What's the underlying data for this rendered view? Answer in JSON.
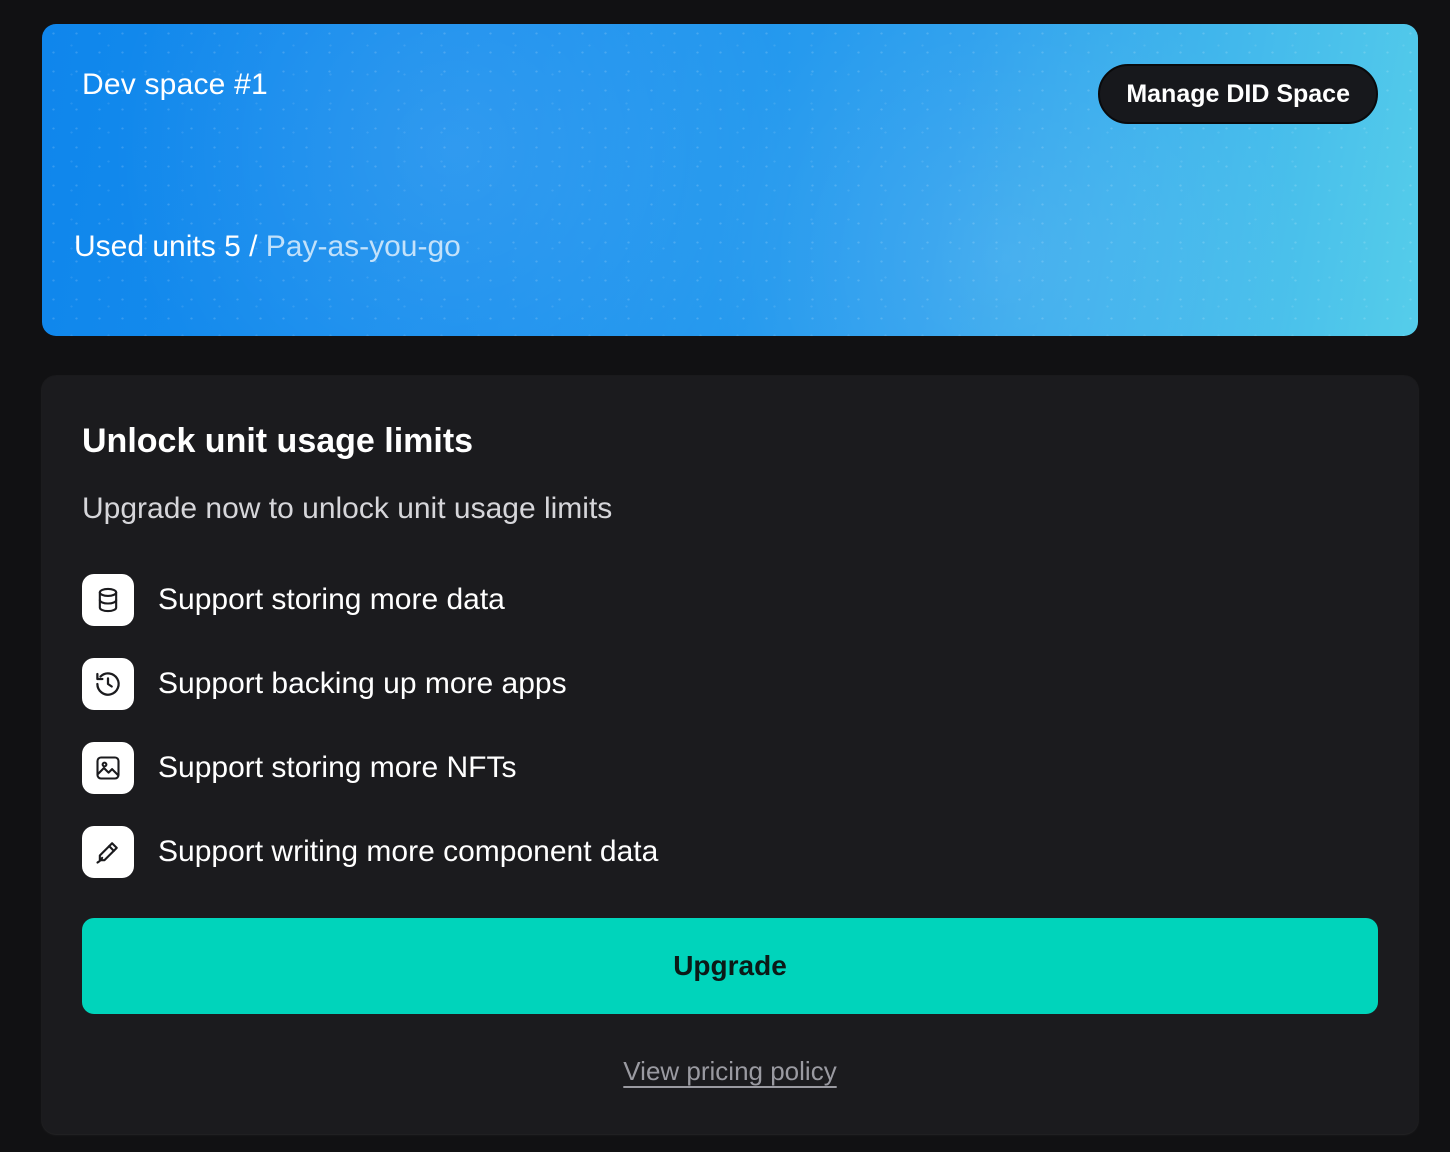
{
  "space": {
    "title": "Dev space #1",
    "manage_button": "Manage DID Space",
    "units_prefix": "Used units 5 / ",
    "plan": "Pay-as-you-go"
  },
  "upgrade": {
    "title": "Unlock unit usage limits",
    "subtitle": "Upgrade now to unlock unit usage limits",
    "features": [
      {
        "icon": "database-icon",
        "label": "Support storing more data"
      },
      {
        "icon": "history-icon",
        "label": "Support backing up more apps"
      },
      {
        "icon": "image-icon",
        "label": "Support storing more NFTs"
      },
      {
        "icon": "pencil-icon",
        "label": "Support writing more component data"
      }
    ],
    "button": "Upgrade",
    "pricing_link": "View pricing policy"
  },
  "colors": {
    "background": "#111113",
    "card": "#1b1b1e",
    "accent": "#00d4bb",
    "banner_start": "#0f86ec",
    "banner_end": "#55cdea"
  }
}
